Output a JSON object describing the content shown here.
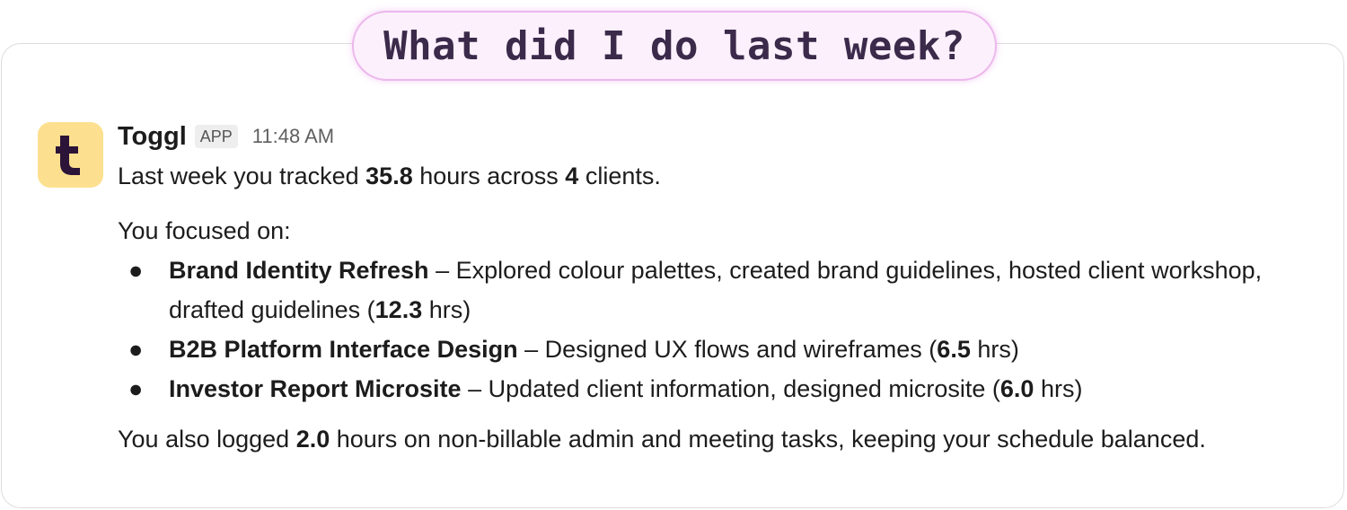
{
  "banner": {
    "text": "What did I do last week?"
  },
  "message": {
    "sender": "Toggl",
    "badge": "APP",
    "time": "11:48 AM",
    "avatar_letter": "t",
    "summary": {
      "prefix": "Last week you tracked ",
      "hours": "35.8",
      "middle": " hours across ",
      "clients": "4",
      "suffix": " clients."
    },
    "focus_intro": "You focused on:",
    "items": [
      {
        "title": "Brand Identity Refresh",
        "desc": " – Explored colour palettes, created brand guidelines, hosted client workshop, drafted guidelines (",
        "hours": "12.3",
        "unit": " hrs)"
      },
      {
        "title": "B2B Platform Interface Design",
        "desc": " – Designed UX flows and wireframes (",
        "hours": "6.5",
        "unit": " hrs)"
      },
      {
        "title": "Investor Report Microsite",
        "desc": " – Updated client information, designed microsite (",
        "hours": "6.0",
        "unit": " hrs)"
      }
    ],
    "admin": {
      "prefix": "You also logged ",
      "hours": "2.0",
      "suffix": " hours on non-billable admin and meeting tasks, keeping your schedule balanced."
    }
  },
  "colors": {
    "avatar_bg": "#fde08f",
    "avatar_fg": "#2c1338",
    "banner_bg": "#fcf0fc",
    "banner_border": "#ecb8ec"
  }
}
